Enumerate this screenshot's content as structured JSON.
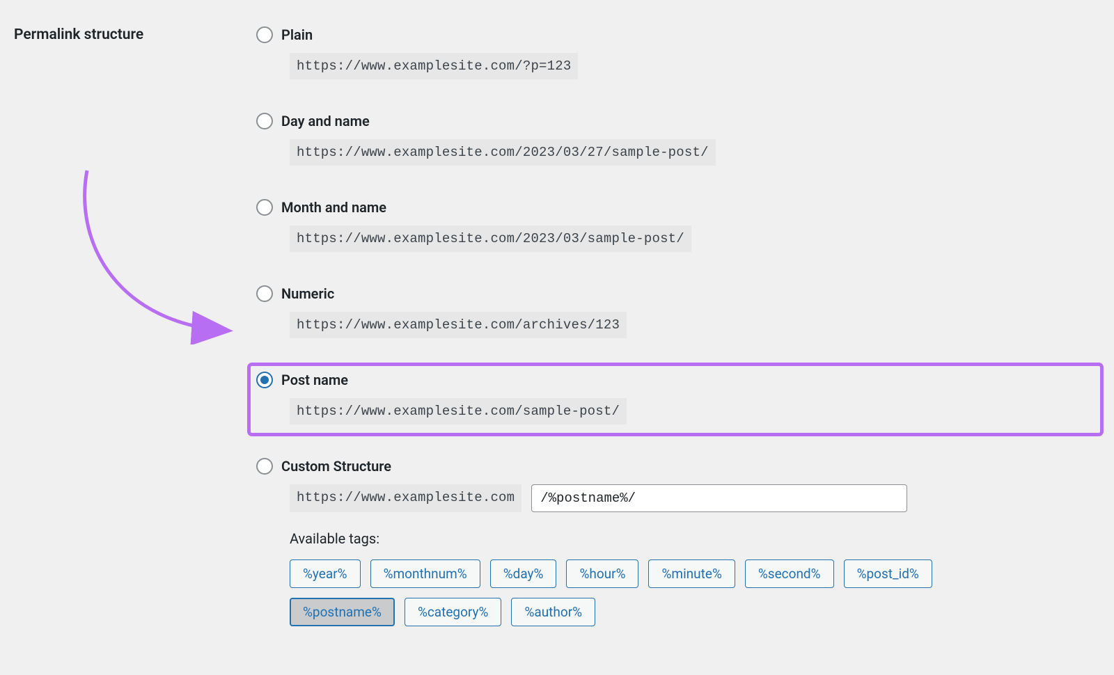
{
  "section_title": "Permalink structure",
  "options": {
    "plain": {
      "label": "Plain",
      "url": "https://www.examplesite.com/?p=123"
    },
    "day_name": {
      "label": "Day and name",
      "url": "https://www.examplesite.com/2023/03/27/sample-post/"
    },
    "month_name": {
      "label": "Month and name",
      "url": "https://www.examplesite.com/2023/03/sample-post/"
    },
    "numeric": {
      "label": "Numeric",
      "url": "https://www.examplesite.com/archives/123"
    },
    "post_name": {
      "label": "Post name",
      "url": "https://www.examplesite.com/sample-post/"
    },
    "custom": {
      "label": "Custom Structure",
      "base_url": "https://www.examplesite.com",
      "input_value": "/%postname%/"
    }
  },
  "available_tags_label": "Available tags:",
  "tags": [
    {
      "text": "%year%",
      "active": false
    },
    {
      "text": "%monthnum%",
      "active": false
    },
    {
      "text": "%day%",
      "active": false
    },
    {
      "text": "%hour%",
      "active": false
    },
    {
      "text": "%minute%",
      "active": false
    },
    {
      "text": "%second%",
      "active": false
    },
    {
      "text": "%post_id%",
      "active": false
    },
    {
      "text": "%postname%",
      "active": true
    },
    {
      "text": "%category%",
      "active": false
    },
    {
      "text": "%author%",
      "active": false
    }
  ],
  "annotation": {
    "highlight": "post_name",
    "arrow_color": "#b86ef2"
  }
}
